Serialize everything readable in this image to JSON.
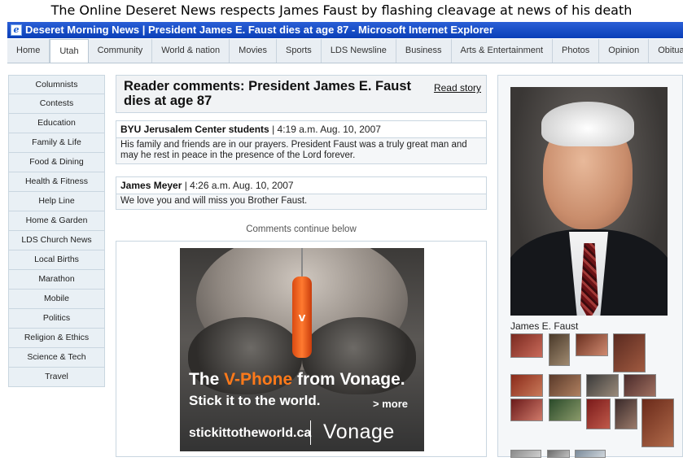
{
  "caption": "The Online Deseret News respects James Faust by flashing cleavage at news of his death",
  "window": {
    "title": "Deseret Morning News | President James E. Faust dies at age 87 - Microsoft Internet Explorer"
  },
  "nav": {
    "tabs": [
      "Home",
      "Utah",
      "Community",
      "World & nation",
      "Movies",
      "Sports",
      "LDS Newsline",
      "Business",
      "Arts & Entertainment",
      "Photos",
      "Opinion",
      "Obituar"
    ],
    "active": "Utah"
  },
  "sidebar": {
    "items": [
      "Columnists",
      "Contests",
      "Education",
      "Family & Life",
      "Food & Dining",
      "Health & Fitness",
      "Help Line",
      "Home & Garden",
      "LDS Church News",
      "Local Births",
      "Marathon",
      "Mobile",
      "Politics",
      "Religion & Ethics",
      "Science & Tech",
      "Travel"
    ]
  },
  "header": {
    "title": "Reader comments: President James E. Faust dies at age 87",
    "read_story": "Read story"
  },
  "comments": [
    {
      "author": "BYU Jerusalem Center students",
      "meta": " | 4:19 a.m. Aug. 10, 2007",
      "text": "His family and friends are in our prayers. President Faust was a truly great man and may he rest in peace in the presence of the Lord forever."
    },
    {
      "author": "James Meyer",
      "meta": " | 4:26 a.m. Aug. 10, 2007",
      "text": "We love you and will miss you Brother Faust."
    }
  ],
  "continue_text": "Comments continue below",
  "ad": {
    "line1_prefix": "The ",
    "line1_product": "V-Phone",
    "line1_suffix": " from Vonage.",
    "line2": "Stick it to the world.",
    "more": "> more",
    "url": "stickittotheworld.ca",
    "brand": "Vonage",
    "phone_mark": "V"
  },
  "photo": {
    "caption": "James E. Faust"
  },
  "colors": {
    "titlebar": "#0a3fb8",
    "nav_bg": "#e9eef3",
    "sidebar_bg": "#e9f0f5",
    "border": "#c9d6e0",
    "ad_accent": "#ff7a1a"
  }
}
